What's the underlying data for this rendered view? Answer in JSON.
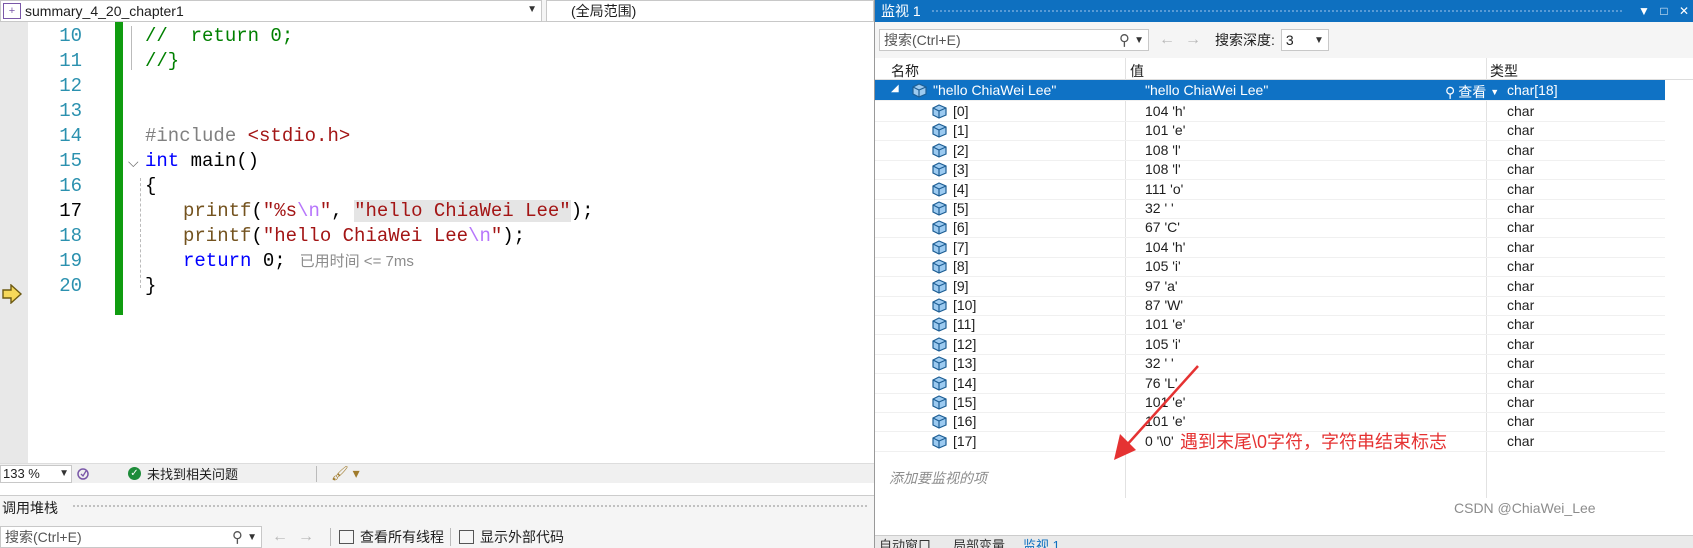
{
  "navbar": {
    "file": "summary_4_20_chapter1",
    "scope": "(全局范围)"
  },
  "code": {
    "line_numbers": [
      "10",
      "11",
      "12",
      "13",
      "14",
      "15",
      "16",
      "17",
      "18",
      "19",
      "20"
    ],
    "current_line": "17",
    "lines": {
      "l10_comment": "//  return 0;",
      "l11_comment": "//}",
      "l14_include": "#include",
      "l14_header": "<stdio.h>",
      "l15_kw": "int",
      "l15_fn": " main()",
      "l16": "{",
      "l17_fn": "printf",
      "l17_open": "(",
      "l17_fmt1": "\"%s",
      "l17_fmt_esc": "\\n",
      "l17_fmt2": "\"",
      "l17_comma": ", ",
      "l17_arg": "\"hello ChiaWei Lee\"",
      "l17_close": ");",
      "l18_fn": "printf",
      "l18_open": "(",
      "l18_str": "\"hello ChiaWei Lee",
      "l18_esc": "\\n",
      "l18_strend": "\"",
      "l18_close": ");",
      "l19_kw": "return",
      "l19_rest": " 0;",
      "l19_perf": "已用时间 <= 7ms",
      "l20": "}"
    }
  },
  "editor_status": {
    "zoom": "133 %",
    "issues": "未找到相关问题"
  },
  "callstack": {
    "title": "调用堆栈",
    "search_placeholder": "搜索(Ctrl+E)",
    "view_all_threads": "查看所有线程",
    "show_external_code": "显示外部代码"
  },
  "watch": {
    "title": "监视 1",
    "search_placeholder": "搜索(Ctrl+E)",
    "depth_label": "搜索深度:",
    "depth_value": "3",
    "columns": {
      "name": "名称",
      "value": "值",
      "type": "类型"
    },
    "root": {
      "name": "\"hello ChiaWei Lee\"",
      "value": "\"hello ChiaWei Lee\"",
      "type": "char[18]",
      "inspect": "查看"
    },
    "items": [
      {
        "name": "[0]",
        "value": "104 'h'",
        "type": "char"
      },
      {
        "name": "[1]",
        "value": "101 'e'",
        "type": "char"
      },
      {
        "name": "[2]",
        "value": "108 'l'",
        "type": "char"
      },
      {
        "name": "[3]",
        "value": "108 'l'",
        "type": "char"
      },
      {
        "name": "[4]",
        "value": "111 'o'",
        "type": "char"
      },
      {
        "name": "[5]",
        "value": "32 ' '",
        "type": "char"
      },
      {
        "name": "[6]",
        "value": "67 'C'",
        "type": "char"
      },
      {
        "name": "[7]",
        "value": "104 'h'",
        "type": "char"
      },
      {
        "name": "[8]",
        "value": "105 'i'",
        "type": "char"
      },
      {
        "name": "[9]",
        "value": "97 'a'",
        "type": "char"
      },
      {
        "name": "[10]",
        "value": "87 'W'",
        "type": "char"
      },
      {
        "name": "[11]",
        "value": "101 'e'",
        "type": "char"
      },
      {
        "name": "[12]",
        "value": "105 'i'",
        "type": "char"
      },
      {
        "name": "[13]",
        "value": "32 ' '",
        "type": "char"
      },
      {
        "name": "[14]",
        "value": "76 'L'",
        "type": "char"
      },
      {
        "name": "[15]",
        "value": "101 'e'",
        "type": "char"
      },
      {
        "name": "[16]",
        "value": "101 'e'",
        "type": "char"
      },
      {
        "name": "[17]",
        "value": "0 '\\0'",
        "type": "char"
      }
    ],
    "add_watch": "添加要监视的项",
    "tabs": [
      "自动窗口",
      "局部变量",
      "监视 1"
    ]
  },
  "annotation": "遇到末尾\\0字符，字符串结束标志",
  "watermark": "CSDN @ChiaWei_Lee",
  "colors": {
    "accent": "#0e70c0",
    "selection": "#0f72c5",
    "changed_bar": "#109c10",
    "annotation": "#e53232"
  }
}
